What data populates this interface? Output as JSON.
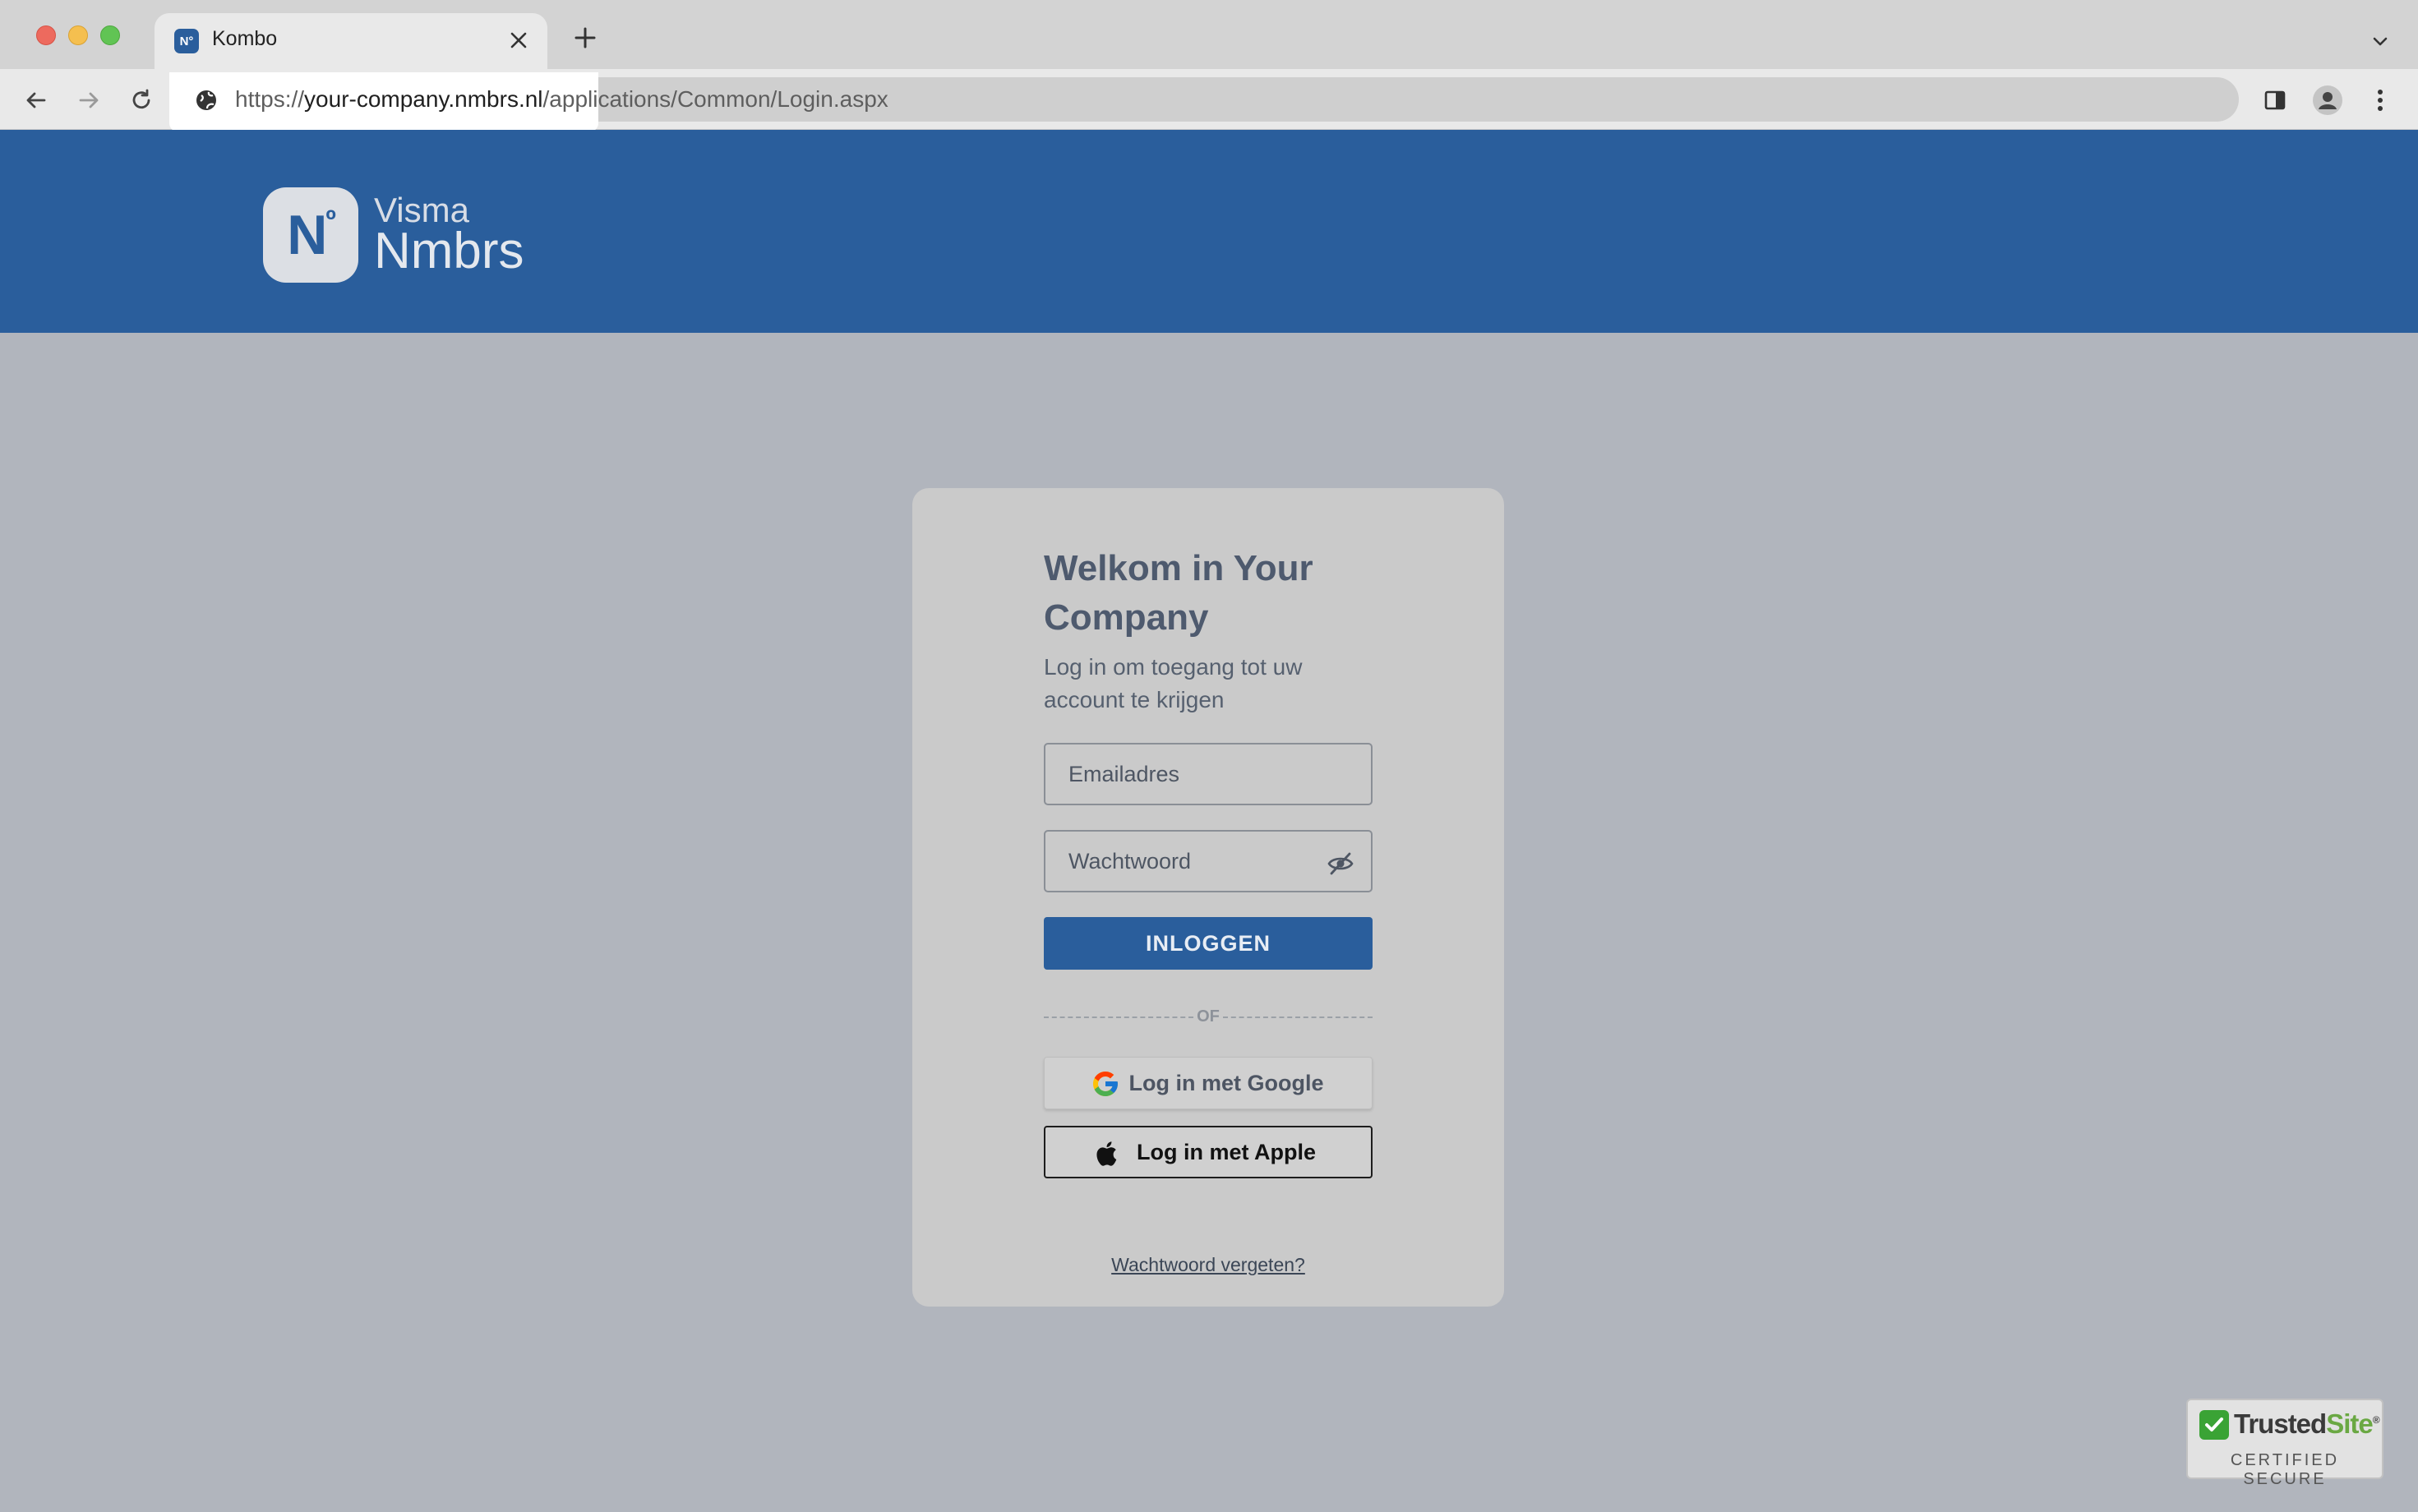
{
  "browser": {
    "tab": {
      "title": "Kombo",
      "favicon_text": "N°"
    },
    "address": {
      "scheme": "https://",
      "host": "your-company.nmbrs.nl",
      "path": "/applications/Common/Login.aspx"
    }
  },
  "header": {
    "logo_mark": "N",
    "logo_sup": "º",
    "brand_top": "Visma",
    "brand_bottom": "Nmbrs"
  },
  "login": {
    "title": "Welkom in Your Company",
    "subtitle": "Log in om toegang tot uw account te krijgen",
    "email_placeholder": "Emailadres",
    "password_placeholder": "Wachtwoord",
    "login_button": "INLOGGEN",
    "divider": "OF",
    "google_button": "Log in met Google",
    "apple_button": "Log in met Apple",
    "forgot_link": "Wachtwoord vergeten?"
  },
  "badge": {
    "name_a": "Trusted",
    "name_b": "Site",
    "reg": "®",
    "subtitle": "CERTIFIED SECURE"
  },
  "colors": {
    "brand_blue": "#2a5e9c",
    "page_bg": "#b1b5bd",
    "card_bg": "#cacaca"
  }
}
